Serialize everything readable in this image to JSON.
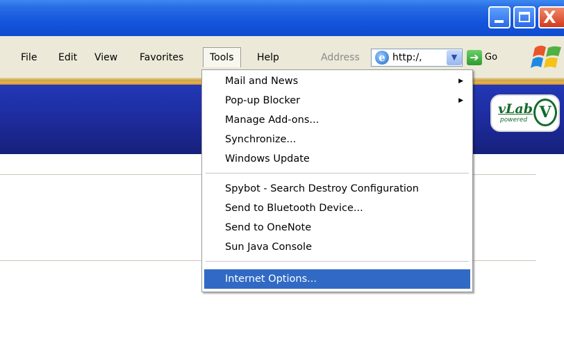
{
  "window": {
    "min_icon": "minimize-icon",
    "max_icon": "maximize-icon",
    "close_glyph": "X"
  },
  "menubar": {
    "items": [
      "File",
      "Edit",
      "View",
      "Favorites",
      "Tools",
      "Help"
    ]
  },
  "address_bar": {
    "label": "Address",
    "value": "http:/,",
    "dropdown_glyph": "▼",
    "go_label": "Go",
    "go_glyph": "➔"
  },
  "ie_glyph": "e",
  "banner": {
    "logo_text": "vLab",
    "logo_sub": "powered",
    "logo_mark": "V"
  },
  "tools_menu": {
    "groups": [
      [
        {
          "label": "Mail and News",
          "submenu": true
        },
        {
          "label": "Pop-up Blocker",
          "submenu": true
        },
        {
          "label": "Manage Add-ons...",
          "submenu": false
        },
        {
          "label": "Synchronize...",
          "submenu": false
        },
        {
          "label": "Windows Update",
          "submenu": false
        }
      ],
      [
        {
          "label": "Spybot - Search  Destroy Configuration",
          "submenu": false
        },
        {
          "label": "Send to Bluetooth Device...",
          "submenu": false
        },
        {
          "label": "Send to OneNote",
          "submenu": false
        },
        {
          "label": "Sun Java Console",
          "submenu": false
        }
      ],
      [
        {
          "label": "Internet Options...",
          "submenu": false,
          "selected": true
        }
      ]
    ],
    "submenu_glyph": "▶"
  },
  "colors": {
    "titlebar": "#1555dc",
    "menubar": "#ece9d8",
    "banner": "#1d2a9a",
    "selection": "#316ac5"
  }
}
